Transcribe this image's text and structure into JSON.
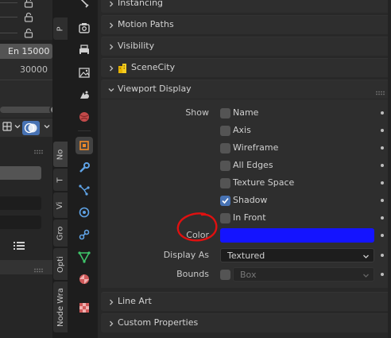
{
  "left_area": {
    "vertical_tabs": [
      "P",
      "No",
      "T",
      "Vi",
      "Gro",
      "Opti",
      "Node Wra"
    ],
    "frame_field": "En  15000",
    "frame_end": "30000"
  },
  "properties": {
    "sections_top": [
      {
        "label": "Instancing"
      },
      {
        "label": "Motion Paths"
      },
      {
        "label": "Visibility"
      },
      {
        "label": "SceneCity"
      }
    ],
    "viewport_display": {
      "title": "Viewport Display",
      "show_label": "Show",
      "checkboxes": [
        {
          "label": "Name",
          "checked": false
        },
        {
          "label": "Axis",
          "checked": false
        },
        {
          "label": "Wireframe",
          "checked": false
        },
        {
          "label": "All Edges",
          "checked": false
        },
        {
          "label": "Texture Space",
          "checked": false
        },
        {
          "label": "Shadow",
          "checked": true
        },
        {
          "label": "In Front",
          "checked": false
        }
      ],
      "color_label": "Color",
      "color_value": "#1414ff",
      "display_as_label": "Display As",
      "display_as_value": "Textured",
      "bounds_label": "Bounds",
      "bounds_value": "Box",
      "bounds_checked": false
    },
    "sections_bottom": [
      {
        "label": "Line Art"
      },
      {
        "label": "Custom Properties"
      }
    ]
  },
  "colors": {
    "accent": "#4772b3",
    "annotation": "#e01010",
    "swatch": "#1414ff"
  },
  "icons": [
    "lock-icon",
    "render-icon",
    "output-icon",
    "view-layer-icon",
    "scene-icon",
    "world-icon",
    "object-icon",
    "modifier-icon",
    "particles-icon",
    "physics-icon",
    "constraints-icon",
    "data-icon",
    "material-icon",
    "texture-icon",
    "list-icon"
  ]
}
